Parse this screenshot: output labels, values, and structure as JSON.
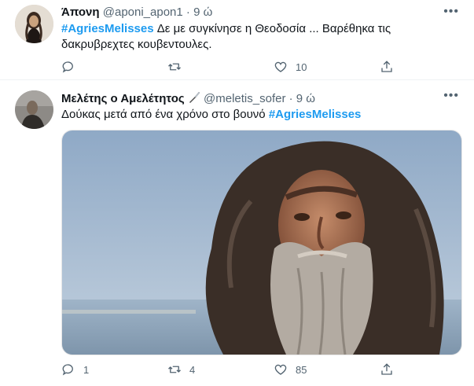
{
  "tweets": [
    {
      "name": "Άπονη",
      "handle": "@aponi_apon1",
      "time": "9 ώ",
      "hashtag": "#AgriesMelisses",
      "text": "Δε με συγκίνησε η Θεοδοσία ... Βαρέθηκα τις δακρυβρεχτες κουβεντουλες.",
      "reply_count": "",
      "retweet_count": "",
      "like_count": "10"
    },
    {
      "name": "Μελέτης ο Αμελέτητος",
      "handle": "@meletis_sofer",
      "time": "9 ώ",
      "text": "Δούκας μετά από ένα χρόνο στο βουνό",
      "hashtag": "#AgriesMelisses",
      "reply_count": "1",
      "retweet_count": "4",
      "like_count": "85"
    }
  ],
  "separator": "·",
  "colors": {
    "accent": "#1d9bf0",
    "muted": "#536471",
    "text": "#0f1419"
  },
  "icons": [
    "reply-icon",
    "retweet-icon",
    "like-icon",
    "share-icon",
    "more-icon",
    "knife-icon"
  ]
}
